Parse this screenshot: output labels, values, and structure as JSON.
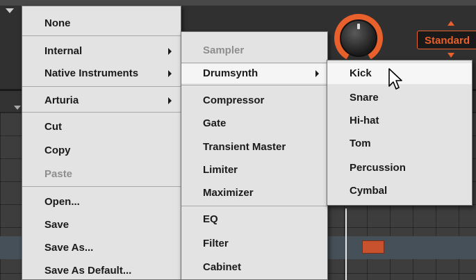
{
  "background": {
    "preset_label": "Standard",
    "accent_color": "#e8602c",
    "pattern_color": "#c8512e"
  },
  "main_menu": {
    "items": [
      {
        "label": "None",
        "submenu": false,
        "enabled": true
      },
      {
        "label": "Internal",
        "submenu": true,
        "enabled": true,
        "active": true
      },
      {
        "label": "Native Instruments",
        "submenu": true,
        "enabled": true
      },
      {
        "label": "Arturia",
        "submenu": true,
        "enabled": true
      },
      {
        "label": "Cut",
        "submenu": false,
        "enabled": true
      },
      {
        "label": "Copy",
        "submenu": false,
        "enabled": true
      },
      {
        "label": "Paste",
        "submenu": false,
        "enabled": false
      },
      {
        "label": "Open...",
        "submenu": false,
        "enabled": true
      },
      {
        "label": "Save",
        "submenu": false,
        "enabled": true
      },
      {
        "label": "Save As...",
        "submenu": false,
        "enabled": true
      },
      {
        "label": "Save As Default...",
        "submenu": false,
        "enabled": true
      }
    ]
  },
  "internal_menu": {
    "items": [
      {
        "label": "Sampler",
        "submenu": false,
        "enabled": false
      },
      {
        "label": "Drumsynth",
        "submenu": true,
        "enabled": true,
        "active": true
      },
      {
        "label": "Compressor",
        "submenu": false,
        "enabled": true
      },
      {
        "label": "Gate",
        "submenu": false,
        "enabled": true
      },
      {
        "label": "Transient Master",
        "submenu": false,
        "enabled": true
      },
      {
        "label": "Limiter",
        "submenu": false,
        "enabled": true
      },
      {
        "label": "Maximizer",
        "submenu": false,
        "enabled": true
      },
      {
        "label": "EQ",
        "submenu": false,
        "enabled": true
      },
      {
        "label": "Filter",
        "submenu": false,
        "enabled": true
      },
      {
        "label": "Cabinet",
        "submenu": false,
        "enabled": true
      }
    ]
  },
  "drumsynth_menu": {
    "items": [
      {
        "label": "Kick",
        "highlighted": true
      },
      {
        "label": "Snare"
      },
      {
        "label": "Hi-hat"
      },
      {
        "label": "Tom"
      },
      {
        "label": "Percussion"
      },
      {
        "label": "Cymbal"
      }
    ]
  },
  "cursor": "arrow-pointer-icon"
}
